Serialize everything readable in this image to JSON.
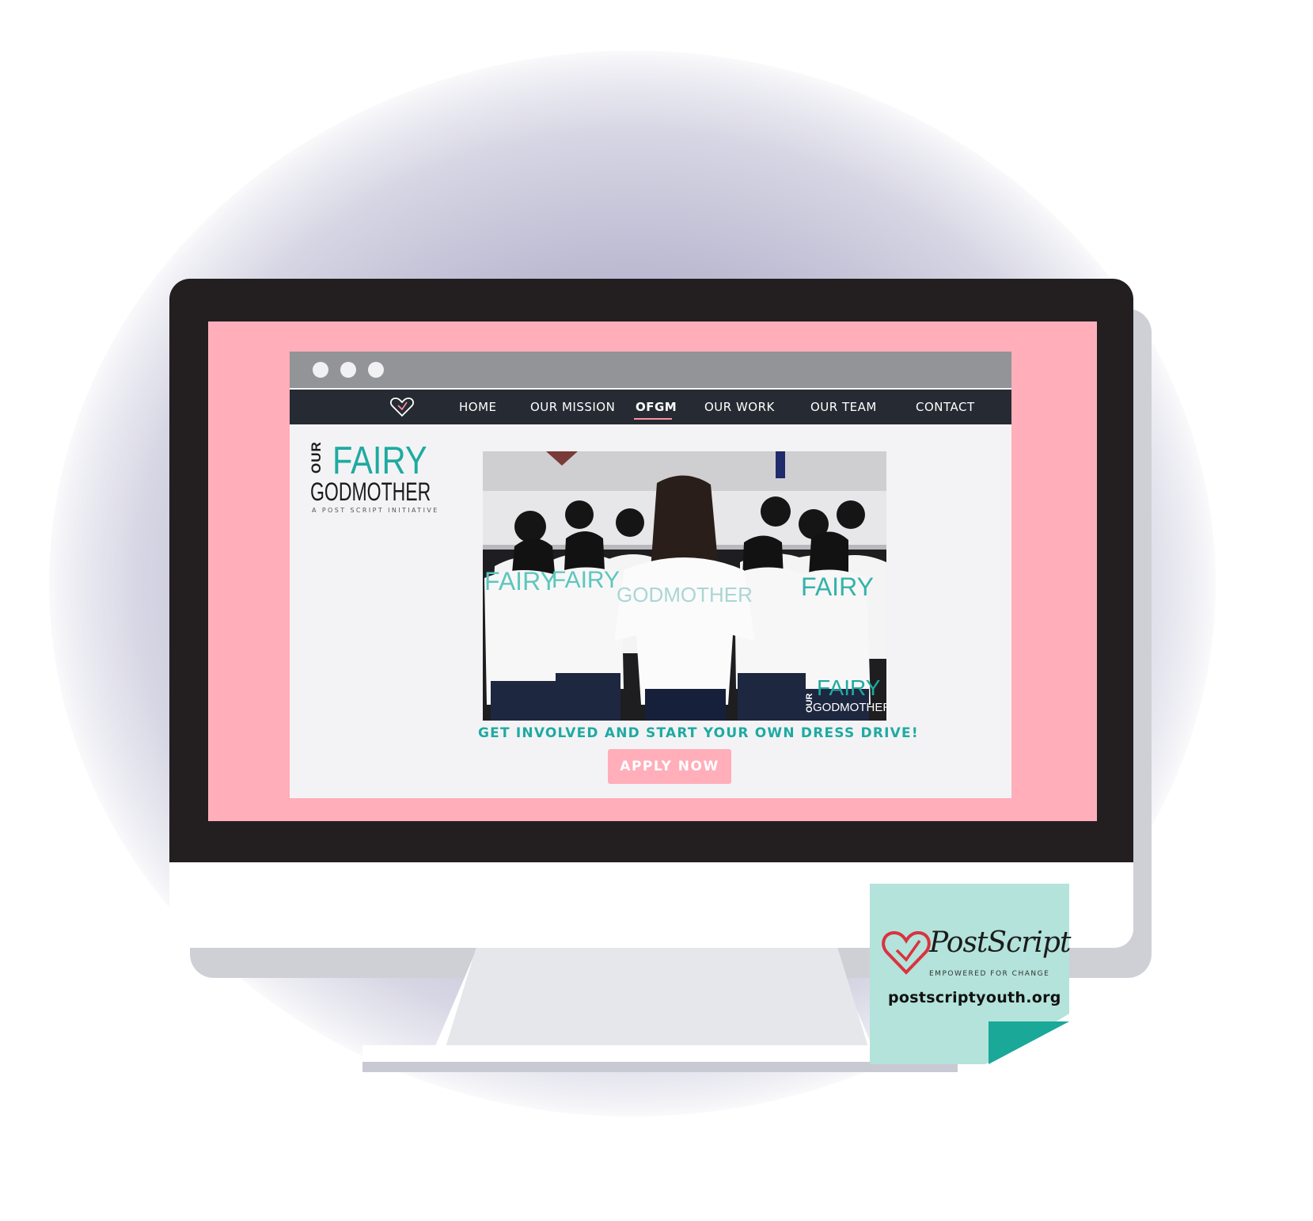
{
  "nav": {
    "items": [
      {
        "label": "HOME",
        "active": false
      },
      {
        "label": "OUR MISSION",
        "active": false
      },
      {
        "label": "OFGM",
        "active": true
      },
      {
        "label": "OUR WORK",
        "active": false
      },
      {
        "label": "OUR TEAM",
        "active": false
      },
      {
        "label": "CONTACT",
        "active": false
      }
    ]
  },
  "brand": {
    "our": "OUR",
    "fairy": "FAIRY",
    "godmother": "GODMOTHER",
    "initiative": "A POST SCRIPT INITIATIVE"
  },
  "hero": {
    "shirt_front": "GODMOTHER",
    "shirt_fairy": "FAIRY",
    "overlay_our": "OUR",
    "overlay_fairy": "FAIRY",
    "overlay_godmother": "GODMOTHER"
  },
  "cta": {
    "headline": "GET INVOLVED AND START YOUR OWN DRESS DRIVE!",
    "button_label": "APPLY NOW"
  },
  "sticky_note": {
    "wordmark": "PostScript",
    "tagline": "EMPOWERED FOR CHANGE",
    "url": "postscriptyouth.org"
  },
  "colors": {
    "screen_pink": "#ffaeba",
    "teal": "#1faaa1",
    "navbar": "#262b33",
    "sticky": "#b3e3db"
  }
}
